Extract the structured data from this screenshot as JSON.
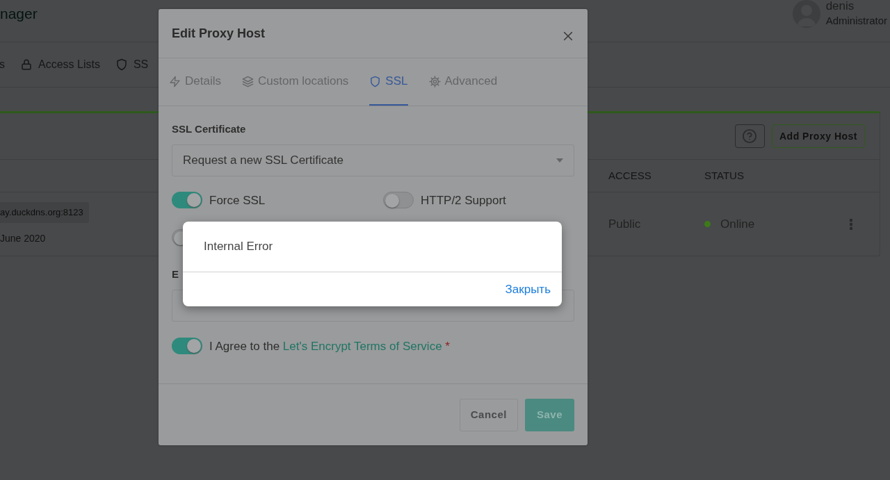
{
  "app_header": {
    "brand": "nager",
    "user": {
      "name": "denis",
      "role": "Administrator"
    }
  },
  "nav": [
    {
      "label": "s",
      "kind": "none"
    },
    {
      "label": "Access Lists",
      "kind": "lock"
    },
    {
      "label": "SS",
      "kind": "shield"
    }
  ],
  "hosts_card": {
    "add_button": "Add Proxy Host",
    "columns": [
      "ACCESS",
      "STATUS"
    ],
    "rows": [
      {
        "host": "ay.duckdns.org:8123",
        "created": "June 2020",
        "access": "Public",
        "status": "Online",
        "color": "#3d7a1a"
      }
    ]
  },
  "edit_modal": {
    "title": "Edit Proxy Host",
    "tabs": [
      {
        "label": "Details",
        "kind": "bolt",
        "selected": false
      },
      {
        "label": "Custom locations",
        "kind": "layers",
        "selected": false
      },
      {
        "label": "SSL",
        "kind": "shield",
        "selected": true
      },
      {
        "label": "Advanced",
        "kind": "gear",
        "selected": false
      }
    ],
    "certificate_label": "SSL Certificate",
    "certificate_value": "Request a new SSL Certificate",
    "toggles": [
      {
        "label": "Force SSL",
        "checked": true
      },
      {
        "label": "HTTP/2 Support",
        "checked": false
      },
      {
        "checked": false
      }
    ],
    "email_label": "E",
    "agree": {
      "checked": true,
      "text": "I Agree to the ",
      "link": "Let's Encrypt Terms of Service",
      "required_mark": "*"
    },
    "buttons": [
      {
        "label": "Cancel",
        "kind": "secondary"
      },
      {
        "label": "Save",
        "kind": "primary"
      }
    ]
  },
  "alert": {
    "message": "Internal Error",
    "button": "Закрыть"
  }
}
